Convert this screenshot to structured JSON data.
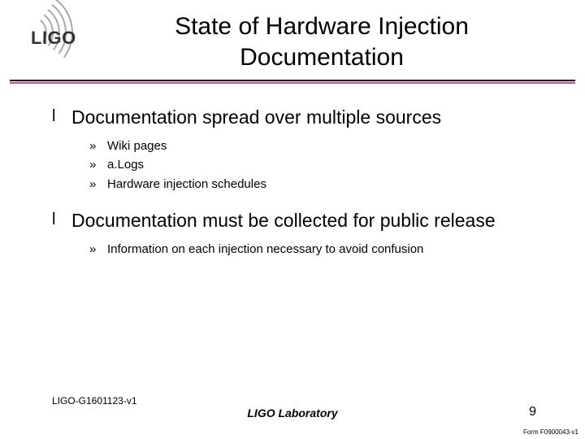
{
  "logo_text": "LIGO",
  "title_line1": "State of Hardware Injection",
  "title_line2": "Documentation",
  "bullets": [
    {
      "text": "Documentation spread over multiple sources",
      "subs": [
        "Wiki pages",
        "a.Logs",
        "Hardware injection schedules"
      ]
    },
    {
      "text": "Documentation must be collected for public release",
      "subs": [
        "Information on each injection necessary to avoid confusion"
      ]
    }
  ],
  "footer": {
    "docnum": "LIGO-G1601123-v1",
    "org": "LIGO Laboratory",
    "page": "9",
    "form": "Form F0900043-v1"
  }
}
